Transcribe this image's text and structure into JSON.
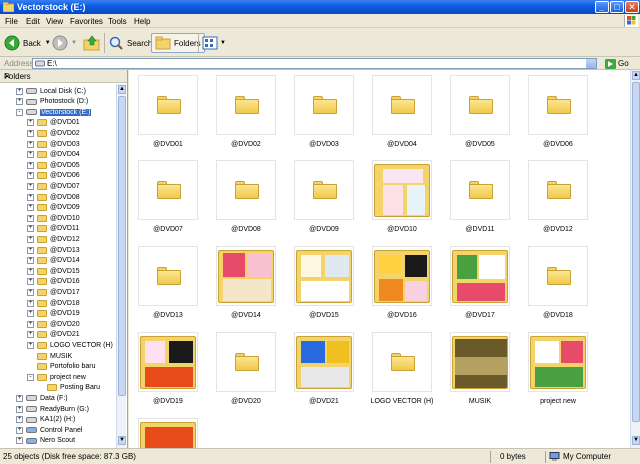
{
  "window": {
    "title": "Vectorstock (E:)"
  },
  "menu": [
    "File",
    "Edit",
    "View",
    "Favorites",
    "Tools",
    "Help"
  ],
  "toolbar": {
    "back": "Back",
    "search": "Search",
    "folders": "Folders"
  },
  "address": {
    "label": "Address",
    "value": "E:\\",
    "go": "Go"
  },
  "folders_pane": {
    "title": "Folders",
    "items": [
      {
        "label": "Local Disk (C:)",
        "level": 1,
        "type": "drive",
        "expander": "+"
      },
      {
        "label": "Photostock (D:)",
        "level": 1,
        "type": "drive",
        "expander": "+"
      },
      {
        "label": "Vectorstock (E:)",
        "level": 1,
        "type": "drive",
        "expander": "-",
        "selected": true
      },
      {
        "label": "@DVD01",
        "level": 2,
        "type": "folder",
        "expander": "+"
      },
      {
        "label": "@DVD02",
        "level": 2,
        "type": "folder",
        "expander": "+"
      },
      {
        "label": "@DVD03",
        "level": 2,
        "type": "folder",
        "expander": "+"
      },
      {
        "label": "@DVD04",
        "level": 2,
        "type": "folder",
        "expander": "+"
      },
      {
        "label": "@DVD05",
        "level": 2,
        "type": "folder",
        "expander": "+"
      },
      {
        "label": "@DVD06",
        "level": 2,
        "type": "folder",
        "expander": "+"
      },
      {
        "label": "@DVD07",
        "level": 2,
        "type": "folder",
        "expander": "+"
      },
      {
        "label": "@DVD08",
        "level": 2,
        "type": "folder",
        "expander": "+"
      },
      {
        "label": "@DVD09",
        "level": 2,
        "type": "folder",
        "expander": "+"
      },
      {
        "label": "@DVD10",
        "level": 2,
        "type": "folder",
        "expander": "+"
      },
      {
        "label": "@DVD11",
        "level": 2,
        "type": "folder",
        "expander": "+"
      },
      {
        "label": "@DVD12",
        "level": 2,
        "type": "folder",
        "expander": "+"
      },
      {
        "label": "@DVD13",
        "level": 2,
        "type": "folder",
        "expander": "+"
      },
      {
        "label": "@DVD14",
        "level": 2,
        "type": "folder",
        "expander": "+"
      },
      {
        "label": "@DVD15",
        "level": 2,
        "type": "folder",
        "expander": "+"
      },
      {
        "label": "@DVD16",
        "level": 2,
        "type": "folder",
        "expander": "+"
      },
      {
        "label": "@DVD17",
        "level": 2,
        "type": "folder",
        "expander": "+"
      },
      {
        "label": "@DVD18",
        "level": 2,
        "type": "folder",
        "expander": "+"
      },
      {
        "label": "@DVD19",
        "level": 2,
        "type": "folder",
        "expander": "+"
      },
      {
        "label": "@DVD20",
        "level": 2,
        "type": "folder",
        "expander": "+"
      },
      {
        "label": "@DVD21",
        "level": 2,
        "type": "folder",
        "expander": "+"
      },
      {
        "label": "LOGO VECTOR (H)",
        "level": 2,
        "type": "folder",
        "expander": "+"
      },
      {
        "label": "MUSIK",
        "level": 2,
        "type": "folder",
        "expander": ""
      },
      {
        "label": "Portofolio baru",
        "level": 2,
        "type": "folder",
        "expander": ""
      },
      {
        "label": "project new",
        "level": 2,
        "type": "folder",
        "expander": "-"
      },
      {
        "label": "Posting Baru",
        "level": 3,
        "type": "folder",
        "expander": ""
      },
      {
        "label": "Data (F:)",
        "level": 1,
        "type": "drive",
        "expander": "+"
      },
      {
        "label": "ReadyBurn (G:)",
        "level": 1,
        "type": "drive",
        "expander": "+"
      },
      {
        "label": "KA1(2) (H:)",
        "level": 1,
        "type": "drive",
        "expander": "+"
      },
      {
        "label": "Control Panel",
        "level": 1,
        "type": "special",
        "expander": "+"
      },
      {
        "label": "Nero Scout",
        "level": 1,
        "type": "special",
        "expander": "+"
      }
    ]
  },
  "content": {
    "items": [
      {
        "label": "@DVD01",
        "thumb": "folder"
      },
      {
        "label": "@DVD02",
        "thumb": "folder"
      },
      {
        "label": "@DVD03",
        "thumb": "folder"
      },
      {
        "label": "@DVD04",
        "thumb": "folder"
      },
      {
        "label": "@DVD05",
        "thumb": "folder"
      },
      {
        "label": "@DVD06",
        "thumb": "folder"
      },
      {
        "label": "@DVD07",
        "thumb": "folder"
      },
      {
        "label": "@DVD08",
        "thumb": "folder"
      },
      {
        "label": "@DVD09",
        "thumb": "folder"
      },
      {
        "label": "@DVD10",
        "thumb": "preview"
      },
      {
        "label": "@DVD11",
        "thumb": "folder"
      },
      {
        "label": "@DVD12",
        "thumb": "folder"
      },
      {
        "label": "@DVD13",
        "thumb": "folder"
      },
      {
        "label": "@DVD14",
        "thumb": "preview"
      },
      {
        "label": "@DVD15",
        "thumb": "preview"
      },
      {
        "label": "@DVD16",
        "thumb": "preview"
      },
      {
        "label": "@DVD17",
        "thumb": "preview"
      },
      {
        "label": "@DVD18",
        "thumb": "folder"
      },
      {
        "label": "@DVD19",
        "thumb": "preview"
      },
      {
        "label": "@DVD20",
        "thumb": "folder"
      },
      {
        "label": "@DVD21",
        "thumb": "preview"
      },
      {
        "label": "LOGO VECTOR (H)",
        "thumb": "folder"
      },
      {
        "label": "MUSIK",
        "thumb": "preview"
      },
      {
        "label": "project new",
        "thumb": "preview"
      },
      {
        "label": "",
        "thumb": "preview"
      }
    ]
  },
  "status": {
    "objects": "25 objects (Disk free space: 87.3 GB)",
    "size": "0 bytes",
    "location": "My Computer"
  },
  "colors": {
    "title_bar": "#0a5ae0",
    "selection": "#316ac5",
    "folder": "#f3d46a"
  }
}
